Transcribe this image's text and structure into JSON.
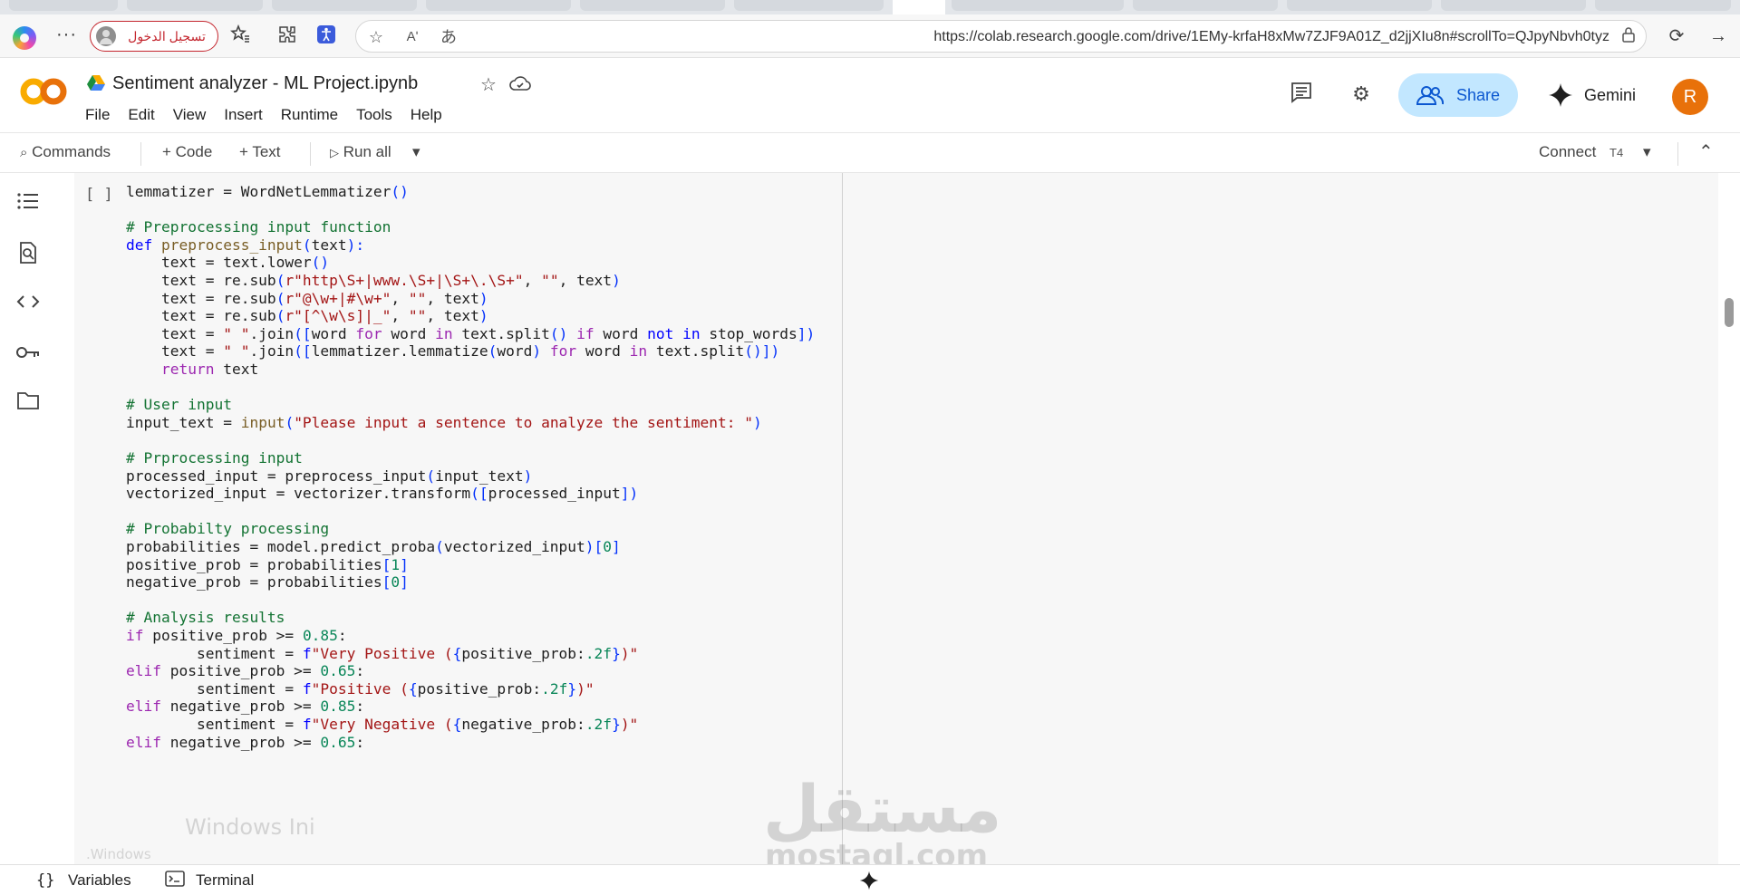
{
  "browser": {
    "profile_label": "تسجيل الدخول",
    "url": "https://colab.research.google.com/drive/1EMy-krfaH8xMw7ZJF9A01Z_d2jjXIu8n#scrollTo=QJpyNbvh0tyz",
    "read_aloud_icon": "Aʹ",
    "translate_icon": "あ"
  },
  "colab": {
    "logo_text": "CO",
    "notebook_title": "Sentiment analyzer - ML Project.ipynb",
    "menu": [
      "File",
      "Edit",
      "View",
      "Insert",
      "Runtime",
      "Tools",
      "Help"
    ],
    "share_label": "Share",
    "gemini_label": "Gemini",
    "avatar_letter": "R"
  },
  "toolbar": {
    "commands_label": "Commands",
    "code_label": "+ Code",
    "text_label": "+ Text",
    "run_all_label": "Run all",
    "connect_label": "Connect",
    "runtime_label": "T4"
  },
  "cell": {
    "run_indicator": "[ ]"
  },
  "status_bar": {
    "variables_label": "Variables",
    "terminal_label": "Terminal"
  },
  "watermark": {
    "brand_arabic": "مستقل",
    "brand_latin": "mostaql.com",
    "windows_text": "Windows Ini",
    "windows_small": ".Windows"
  },
  "code": [
    [
      [
        "t",
        "lemmatizer = WordNetLemmatizer"
      ],
      [
        "br",
        "()"
      ]
    ],
    [],
    [
      [
        "com",
        "# Preprocessing input function"
      ]
    ],
    [
      [
        "kw",
        "def "
      ],
      [
        "fn",
        "preprocess_input"
      ],
      [
        "br",
        "("
      ],
      [
        "t",
        "text"
      ],
      [
        "br",
        "):"
      ]
    ],
    [
      [
        "t",
        "    text = text.lower"
      ],
      [
        "br",
        "()"
      ]
    ],
    [
      [
        "t",
        "    text = re.sub"
      ],
      [
        "br",
        "("
      ],
      [
        "str",
        "r\"http\\S+|www.\\S+|\\S+\\.\\S+\""
      ],
      [
        "t",
        ", "
      ],
      [
        "str",
        "\"\""
      ],
      [
        "t",
        ", text"
      ],
      [
        "br",
        ")"
      ]
    ],
    [
      [
        "t",
        "    text = re.sub"
      ],
      [
        "br",
        "("
      ],
      [
        "str",
        "r\"@\\w+|#\\w+\""
      ],
      [
        "t",
        ", "
      ],
      [
        "str",
        "\"\""
      ],
      [
        "t",
        ", text"
      ],
      [
        "br",
        ")"
      ]
    ],
    [
      [
        "t",
        "    text = re.sub"
      ],
      [
        "br",
        "("
      ],
      [
        "str",
        "r\"[^\\w\\s]|_\""
      ],
      [
        "t",
        ", "
      ],
      [
        "str",
        "\"\""
      ],
      [
        "t",
        ", text"
      ],
      [
        "br",
        ")"
      ]
    ],
    [
      [
        "t",
        "    text = "
      ],
      [
        "str",
        "\" \""
      ],
      [
        "t",
        ".join"
      ],
      [
        "br",
        "(["
      ],
      [
        "t",
        "word "
      ],
      [
        "kw2",
        "for"
      ],
      [
        "t",
        " word "
      ],
      [
        "kw2",
        "in"
      ],
      [
        "t",
        " text.split"
      ],
      [
        "br",
        "()"
      ],
      [
        "t",
        " "
      ],
      [
        "kw2",
        "if"
      ],
      [
        "t",
        " word "
      ],
      [
        "kw",
        "not in"
      ],
      [
        "t",
        " stop_words"
      ],
      [
        "br",
        "])"
      ]
    ],
    [
      [
        "t",
        "    text = "
      ],
      [
        "str",
        "\" \""
      ],
      [
        "t",
        ".join"
      ],
      [
        "br",
        "(["
      ],
      [
        "t",
        "lemmatizer.lemmatize"
      ],
      [
        "br",
        "("
      ],
      [
        "t",
        "word"
      ],
      [
        "br",
        ")"
      ],
      [
        "t",
        " "
      ],
      [
        "kw2",
        "for"
      ],
      [
        "t",
        " word "
      ],
      [
        "kw2",
        "in"
      ],
      [
        "t",
        " text.split"
      ],
      [
        "br",
        "()])"
      ]
    ],
    [
      [
        "kw2",
        "    return"
      ],
      [
        "t",
        " text"
      ]
    ],
    [],
    [
      [
        "com",
        "# User input"
      ]
    ],
    [
      [
        "t",
        "input_text = "
      ],
      [
        "fn",
        "input"
      ],
      [
        "br",
        "("
      ],
      [
        "str",
        "\"Please input a sentence to analyze the sentiment: \""
      ],
      [
        "br",
        ")"
      ]
    ],
    [],
    [
      [
        "com",
        "# Prprocessing input"
      ]
    ],
    [
      [
        "t",
        "processed_input = preprocess_input"
      ],
      [
        "br",
        "("
      ],
      [
        "t",
        "input_text"
      ],
      [
        "br",
        ")"
      ]
    ],
    [
      [
        "t",
        "vectorized_input = vectorizer.transform"
      ],
      [
        "br",
        "(["
      ],
      [
        "t",
        "processed_input"
      ],
      [
        "br",
        "])"
      ]
    ],
    [],
    [
      [
        "com",
        "# Probabilty processing"
      ]
    ],
    [
      [
        "t",
        "probabilities = model.predict_proba"
      ],
      [
        "br",
        "("
      ],
      [
        "t",
        "vectorized_input"
      ],
      [
        "br",
        ")["
      ],
      [
        "num",
        "0"
      ],
      [
        "br",
        "]"
      ]
    ],
    [
      [
        "t",
        "positive_prob = probabilities"
      ],
      [
        "br",
        "["
      ],
      [
        "num",
        "1"
      ],
      [
        "br",
        "]"
      ]
    ],
    [
      [
        "t",
        "negative_prob = probabilities"
      ],
      [
        "br",
        "["
      ],
      [
        "num",
        "0"
      ],
      [
        "br",
        "]"
      ]
    ],
    [],
    [
      [
        "com",
        "# Analysis results"
      ]
    ],
    [
      [
        "kw2",
        "if"
      ],
      [
        "t",
        " positive_prob >= "
      ],
      [
        "num",
        "0.85"
      ],
      [
        "t",
        ":"
      ]
    ],
    [
      [
        "t",
        "        sentiment = "
      ],
      [
        "kw",
        "f"
      ],
      [
        "str",
        "\"Very Positive ("
      ],
      [
        "br",
        "{"
      ],
      [
        "t",
        "positive_prob:"
      ],
      [
        "num",
        ".2f"
      ],
      [
        "br",
        "}"
      ],
      [
        "str",
        ")\""
      ]
    ],
    [
      [
        "kw2",
        "elif"
      ],
      [
        "t",
        " positive_prob >= "
      ],
      [
        "num",
        "0.65"
      ],
      [
        "t",
        ":"
      ]
    ],
    [
      [
        "t",
        "        sentiment = "
      ],
      [
        "kw",
        "f"
      ],
      [
        "str",
        "\"Positive ("
      ],
      [
        "br",
        "{"
      ],
      [
        "t",
        "positive_prob:"
      ],
      [
        "num",
        ".2f"
      ],
      [
        "br",
        "}"
      ],
      [
        "str",
        ")\""
      ]
    ],
    [
      [
        "kw2",
        "elif"
      ],
      [
        "t",
        " negative_prob >= "
      ],
      [
        "num",
        "0.85"
      ],
      [
        "t",
        ":"
      ]
    ],
    [
      [
        "t",
        "        sentiment = "
      ],
      [
        "kw",
        "f"
      ],
      [
        "str",
        "\"Very Negative ("
      ],
      [
        "br",
        "{"
      ],
      [
        "t",
        "negative_prob:"
      ],
      [
        "num",
        ".2f"
      ],
      [
        "br",
        "}"
      ],
      [
        "str",
        ")\""
      ]
    ],
    [
      [
        "kw2",
        "elif"
      ],
      [
        "t",
        " negative_prob >= "
      ],
      [
        "num",
        "0.65"
      ],
      [
        "t",
        ":"
      ]
    ]
  ],
  "colors": {
    "share_bg": "#c2e7ff",
    "share_fg": "#0b57d0",
    "avatar_bg": "#e8710a",
    "profile_border": "#c4262e",
    "comment": "#137333",
    "keyword": "#0000ff",
    "control_keyword": "#9c27b0",
    "string": "#a31515",
    "number": "#098658"
  },
  "icons": {
    "browser": [
      "copilot-icon",
      "more-icon",
      "favorites-icon",
      "extensions-icon",
      "accessibility-icon",
      "star-icon",
      "read-aloud-icon",
      "translate-icon",
      "lock-icon",
      "refresh-icon",
      "forward-icon"
    ],
    "colab": [
      "drive-icon",
      "star-icon",
      "cloud-sync-icon",
      "comment-icon",
      "settings-gear-icon",
      "share-people-icon",
      "gemini-sparkle-icon"
    ],
    "sidebar": [
      "table-of-contents-icon",
      "find-replace-icon",
      "code-snippets-icon",
      "secrets-key-icon",
      "files-folder-icon"
    ],
    "status": [
      "variables-braces-icon",
      "terminal-icon",
      "gemini-sparkle-icon"
    ]
  }
}
